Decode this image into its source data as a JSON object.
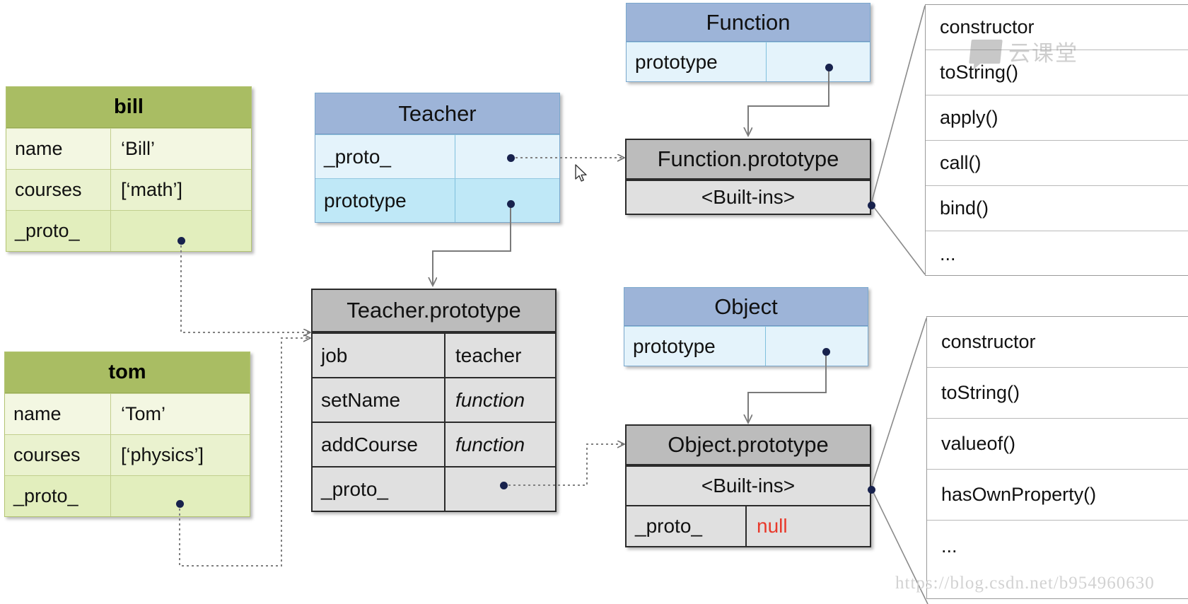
{
  "diagram": {
    "title": "JavaScript prototype chain diagram",
    "colors": {
      "green_header": "#a9bd63",
      "green_body": "#eaf2cf",
      "blue_header": "#9db4d8",
      "blue_body": "#bfe8f7",
      "gray_header": "#bcbcbc",
      "gray_body": "#e0e0e0",
      "null_red": "#e8392b",
      "dot": "#18224d"
    }
  },
  "boxes": {
    "bill": {
      "title": "bill",
      "rows": [
        {
          "label": "name",
          "value": "‘Bill’"
        },
        {
          "label": "courses",
          "value": "[‘math’]"
        },
        {
          "label": "_proto_",
          "value": ""
        }
      ]
    },
    "tom": {
      "title": "tom",
      "rows": [
        {
          "label": "name",
          "value": "‘Tom’"
        },
        {
          "label": "courses",
          "value": "[‘physics’]"
        },
        {
          "label": "_proto_",
          "value": ""
        }
      ]
    },
    "teacher": {
      "title": "Teacher",
      "rows": [
        {
          "label": "_proto_",
          "value": ""
        },
        {
          "label": "prototype",
          "value": ""
        }
      ]
    },
    "teacher_prototype": {
      "title": "Teacher.prototype",
      "rows": [
        {
          "label": "job",
          "value": "teacher"
        },
        {
          "label": "setName",
          "value": "function"
        },
        {
          "label": "addCourse",
          "value": "function"
        },
        {
          "label": "_proto_",
          "value": ""
        }
      ]
    },
    "function": {
      "title": "Function",
      "rows": [
        {
          "label": "prototype",
          "value": ""
        }
      ]
    },
    "function_prototype": {
      "title": "Function.prototype",
      "rows": [
        {
          "label": "<Built-ins>",
          "value": ""
        }
      ]
    },
    "object": {
      "title": "Object",
      "rows": [
        {
          "label": "prototype",
          "value": ""
        }
      ]
    },
    "object_prototype": {
      "title": "Object.prototype",
      "builtins_label": "<Built-ins>",
      "rows": [
        {
          "label": "_proto_",
          "value": "null"
        }
      ]
    }
  },
  "callouts": {
    "function_builtins": {
      "items": [
        "constructor",
        "toString()",
        "apply()",
        "call()",
        "bind()",
        "..."
      ]
    },
    "object_builtins": {
      "items": [
        "constructor",
        "toString()",
        "valueof()",
        "hasOwnProperty()",
        "..."
      ]
    }
  },
  "watermark": {
    "brand": "云课堂",
    "url": "https://blog.csdn.net/b954960630"
  }
}
